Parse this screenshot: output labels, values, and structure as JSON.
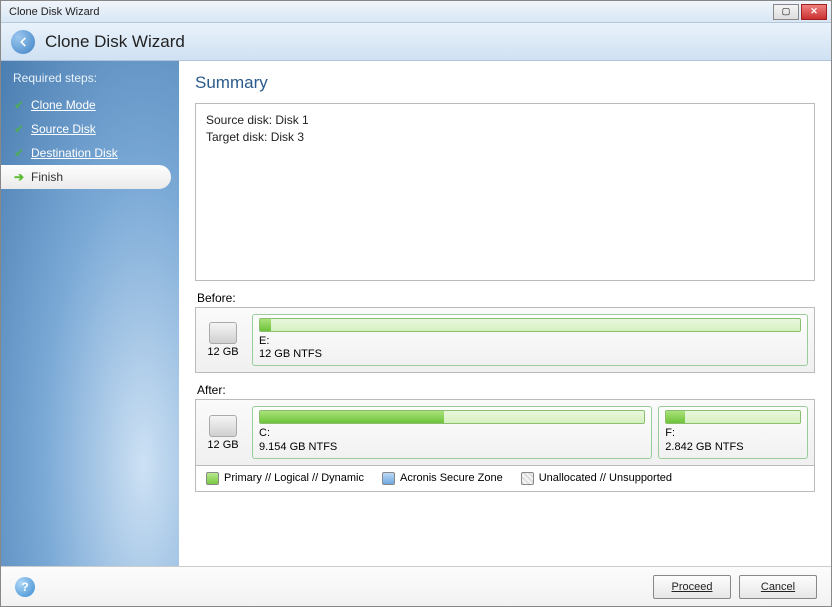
{
  "window": {
    "title": "Clone Disk Wizard"
  },
  "header": {
    "title": "Clone Disk Wizard"
  },
  "sidebar": {
    "required_label": "Required steps:",
    "steps": [
      {
        "label": "Clone Mode",
        "state": "done"
      },
      {
        "label": "Source Disk",
        "state": "done"
      },
      {
        "label": "Destination Disk",
        "state": "done"
      },
      {
        "label": "Finish",
        "state": "current"
      }
    ]
  },
  "main": {
    "title": "Summary",
    "info_lines": {
      "source": "Source disk: Disk 1",
      "target": "Target disk: Disk 3"
    },
    "before": {
      "label": "Before:",
      "disk_size": "12 GB",
      "partitions": [
        {
          "letter": "E:",
          "desc": "12 GB  NTFS",
          "width_pct": 100,
          "fill_pct": 2
        }
      ]
    },
    "after": {
      "label": "After:",
      "disk_size": "12 GB",
      "partitions": [
        {
          "letter": "C:",
          "desc": "9.154 GB  NTFS",
          "width_pct": 74,
          "fill_pct": 48
        },
        {
          "letter": "F:",
          "desc": "2.842 GB  NTFS",
          "width_pct": 26,
          "fill_pct": 14
        }
      ]
    },
    "legend": {
      "primary": "Primary // Logical // Dynamic",
      "secure": "Acronis Secure Zone",
      "unalloc": "Unallocated // Unsupported"
    }
  },
  "footer": {
    "proceed": "Proceed",
    "cancel": "Cancel"
  }
}
